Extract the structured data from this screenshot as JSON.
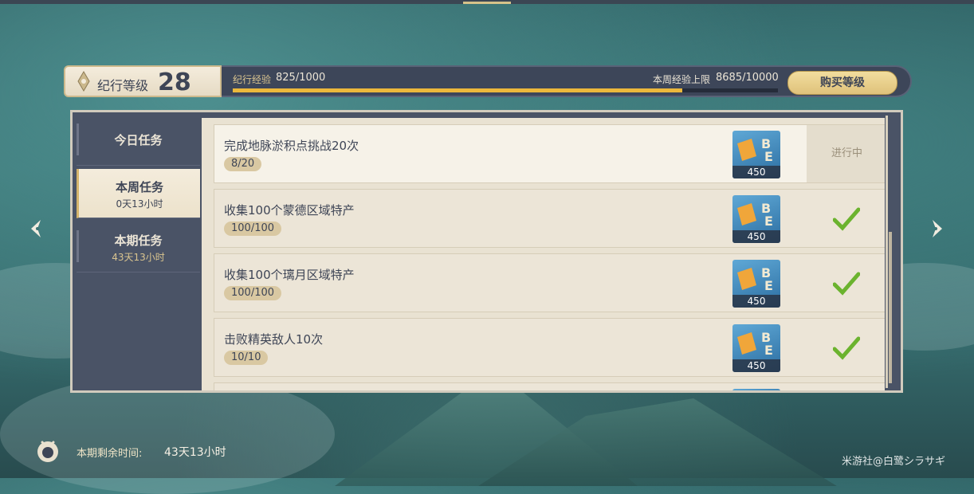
{
  "header": {
    "level_label": "纪行等级",
    "level_value": "28",
    "exp_label": "纪行经验",
    "exp_value": "825/1000",
    "exp_progress": 0.825,
    "weekly_cap_label": "本周经验上限",
    "weekly_cap_value": "8685/10000",
    "buy_level_label": "购买等级"
  },
  "sidebar": {
    "tabs": [
      {
        "label": "今日任务",
        "sub": ""
      },
      {
        "label": "本周任务",
        "sub": "0天13小时"
      },
      {
        "label": "本期任务",
        "sub": "43天13小时"
      }
    ]
  },
  "tasks": [
    {
      "title": "完成地脉淤积点挑战20次",
      "progress": "8/20",
      "reward": "450",
      "status": "进行中"
    },
    {
      "title": "收集100个蒙德区域特产",
      "progress": "100/100",
      "reward": "450",
      "status": "check-icon"
    },
    {
      "title": "收集100个璃月区域特产",
      "progress": "100/100",
      "reward": "450",
      "status": "check-icon"
    },
    {
      "title": "击败精英敌人10次",
      "progress": "10/10",
      "reward": "450",
      "status": "check-icon"
    }
  ],
  "footer": {
    "remaining_label": "本期剩余时间:",
    "remaining_value": "43天13小时"
  },
  "watermark": "米游社@白鹭シラサギ",
  "colors": {
    "accent": "#ecb83c",
    "panel": "#4a5366",
    "card": "#ece5d7",
    "check": "#6bb32e"
  }
}
